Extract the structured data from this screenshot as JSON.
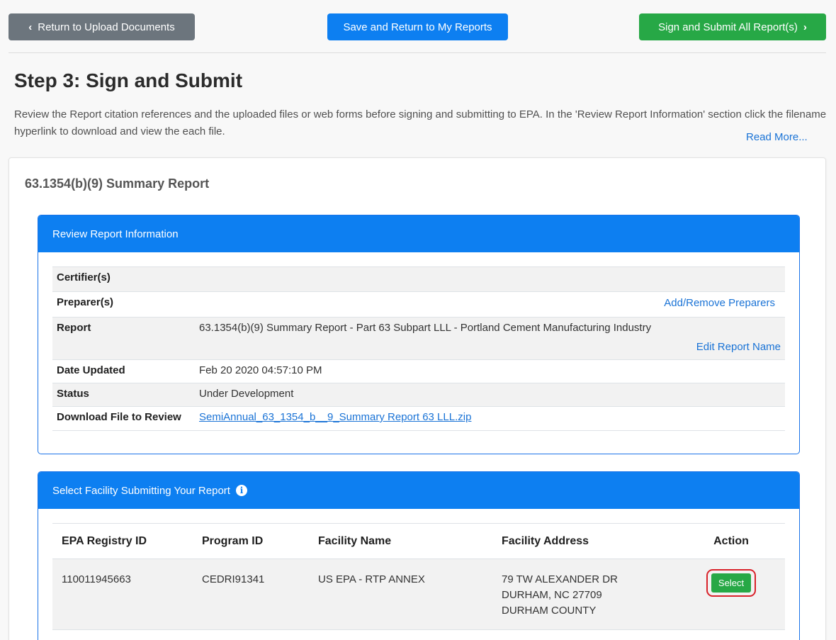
{
  "toolbar": {
    "back_label": "Return to Upload Documents",
    "save_label": "Save and Return to My Reports",
    "sign_label": "Sign and Submit All Report(s)"
  },
  "page": {
    "title": "Step 3: Sign and Submit",
    "intro": "Review the Report citation references and the uploaded files or web forms before signing and submitting to EPA. In the 'Review Report Information' section click the filename hyperlink to download and view the each file.",
    "read_more": "Read More..."
  },
  "report": {
    "title": "63.1354(b)(9) Summary Report"
  },
  "review_panel": {
    "heading": "Review Report Information",
    "rows": [
      {
        "label": "Certifier(s)",
        "value": ""
      },
      {
        "label": "Preparer(s)",
        "value": "",
        "action": "Add/Remove Preparers"
      },
      {
        "label": "Report",
        "value": "63.1354(b)(9) Summary Report - Part 63 Subpart LLL - Portland Cement Manufacturing Industry",
        "action": "Edit Report Name"
      },
      {
        "label": "Date Updated",
        "value": "Feb 20 2020 04:57:10 PM"
      },
      {
        "label": "Status",
        "value": "Under Development"
      },
      {
        "label": "Download File to Review",
        "value": "SemiAnnual_63_1354_b__9_Summary Report 63 LLL.zip"
      }
    ]
  },
  "facility_panel": {
    "heading": "Select Facility Submitting Your Report",
    "columns": [
      "EPA Registry ID",
      "Program ID",
      "Facility Name",
      "Facility Address",
      "Action"
    ],
    "rows": [
      {
        "registry_id": "110011945663",
        "program_id": "CEDRI91341",
        "facility_name": "US EPA - RTP ANNEX",
        "address_line1": "79 TW ALEXANDER DR",
        "address_line2": "DURHAM, NC 27709",
        "address_line3": "DURHAM COUNTY",
        "action_label": "Select"
      }
    ]
  },
  "colors": {
    "primary": "#0d7ff1",
    "success": "#27a846",
    "secondary": "#6c757d",
    "highlight": "#d9222a"
  }
}
